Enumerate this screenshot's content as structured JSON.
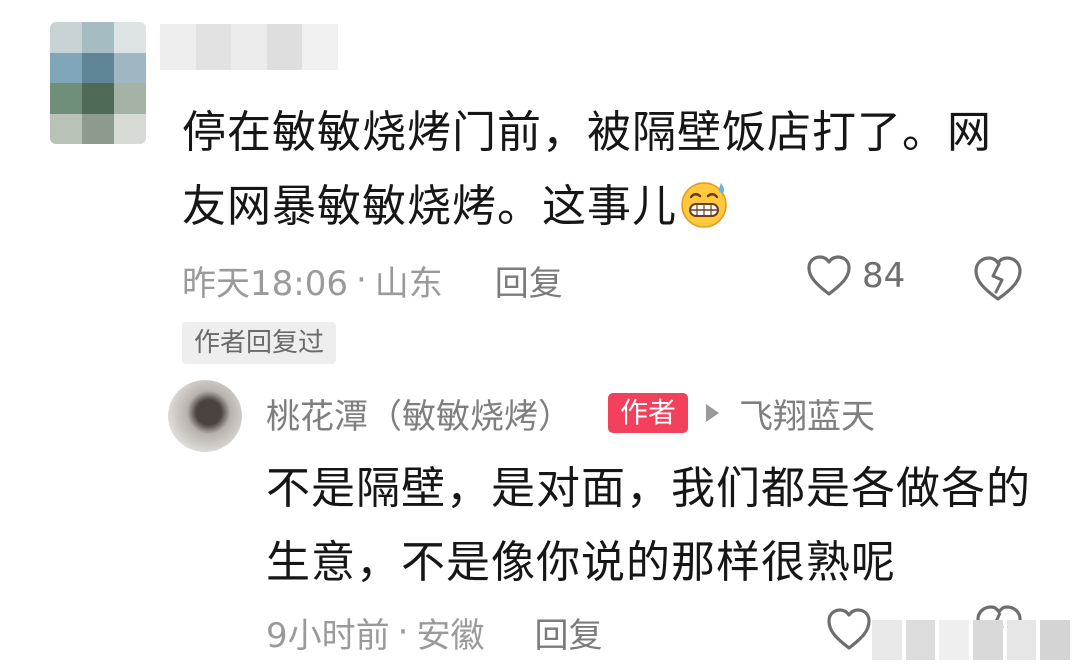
{
  "comment": {
    "avatar_icon": "pixelated-avatar",
    "username_blurred": true,
    "text": "停在敏敏烧烤门前，被隔壁饭店打了。网友网暴敏敏烧烤。这事儿",
    "emoji": "grinning-sweat-emoji",
    "time": "昨天18:06",
    "separator": "·",
    "location": "山东",
    "reply_label": "回复",
    "like_icon": "heart-outline-icon",
    "like_count": "84",
    "dislike_icon": "broken-heart-icon",
    "author_replied_badge": "作者回复过"
  },
  "reply": {
    "avatar_icon": "blurred-avatar",
    "username": "桃花潭（敏敏烧烤）",
    "author_tag": "作者",
    "reply_arrow_icon": "play-arrow-icon",
    "reply_to": "飞翔蓝天",
    "text": "不是隔壁，是对面，我们都是各做各的生意，不是像你说的那样很熟呢",
    "time": "9小时前",
    "separator": "·",
    "location": "安徽",
    "reply_label": "回复",
    "like_icon": "heart-outline-icon",
    "dislike_icon": "broken-heart-icon",
    "watermark_obscured": true
  },
  "colors": {
    "text_primary": "#161616",
    "text_secondary": "#9a9a9a",
    "author_tag_bg": "#f2405d",
    "badge_bg": "#eeeeee"
  }
}
